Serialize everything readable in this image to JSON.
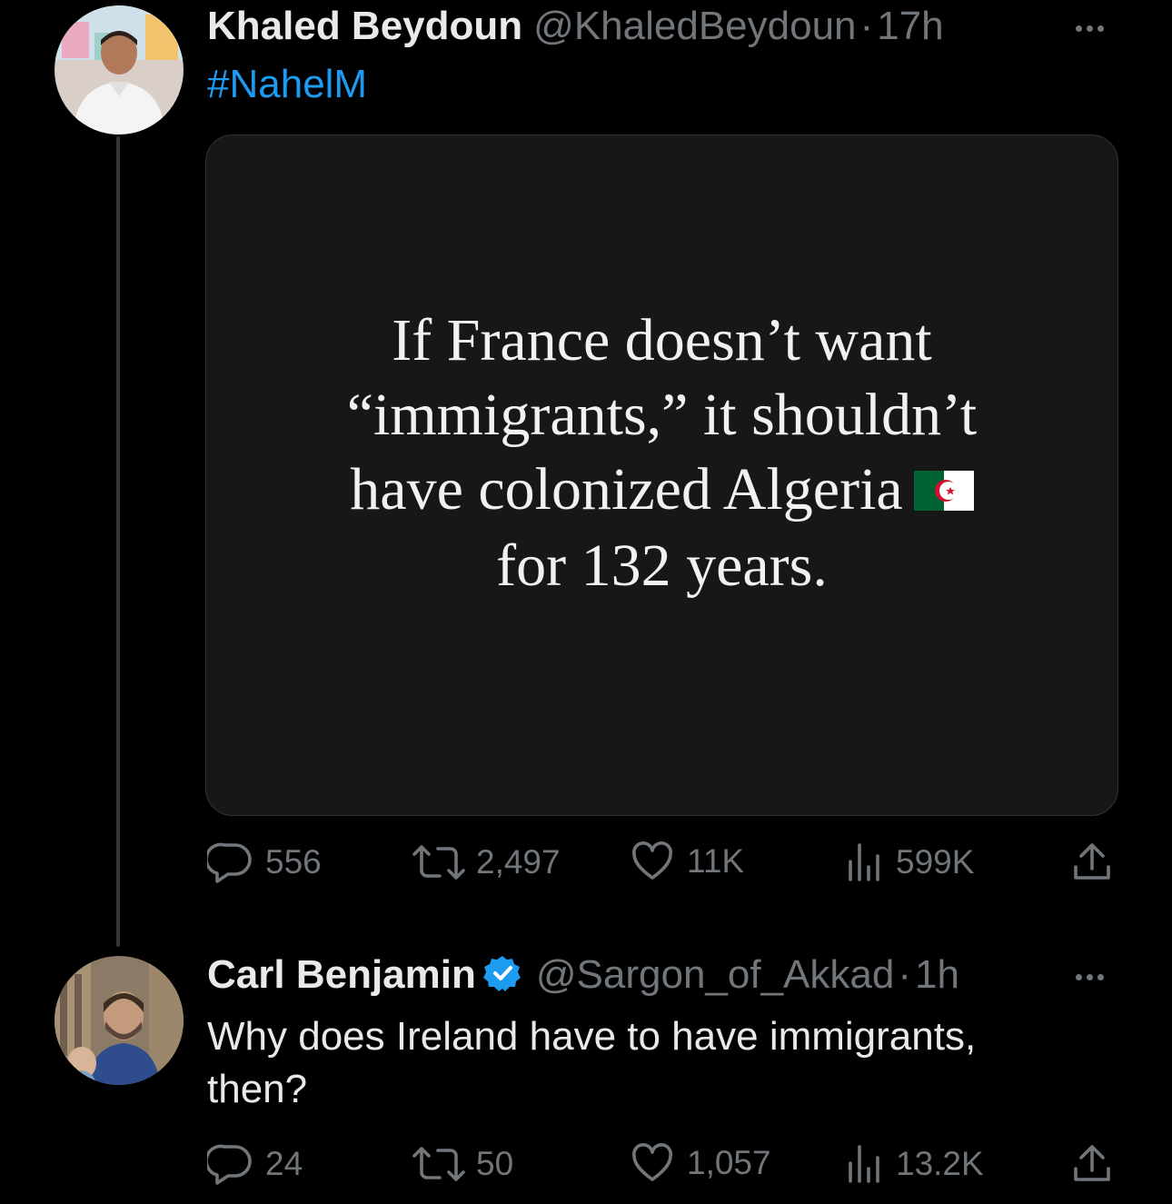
{
  "tweet": {
    "author_name": "Khaled Beydoun",
    "author_handle": "@KhaledBeydoun",
    "separator": "·",
    "time": "17h",
    "hashtag": "#NahelM",
    "image_quote_lines": [
      "If France doesn’t want",
      "“immigrants,” it shouldn’t",
      "have colonized Algeria",
      "for 132 years."
    ],
    "stats": {
      "replies": "556",
      "retweets": "2,497",
      "likes": "11K",
      "views": "599K"
    }
  },
  "reply": {
    "author_name": "Carl Benjamin",
    "author_handle": "@Sargon_of_Akkad",
    "separator": "·",
    "time": "1h",
    "verified": true,
    "text": "Why does Ireland have to have immigrants, then?",
    "stats": {
      "replies": "24",
      "retweets": "50",
      "likes": "1,057",
      "views": "13.2K"
    }
  },
  "colors": {
    "background": "#000000",
    "text": "#e7e9ea",
    "muted": "#71767b",
    "link": "#1d9bf0",
    "thread_line": "#333639",
    "algeria_green": "#006233",
    "algeria_red": "#d21034"
  },
  "icons": [
    "reply-icon",
    "retweet-icon",
    "like-icon",
    "views-icon",
    "share-icon",
    "more-icon",
    "verified-badge-icon",
    "algeria-flag-icon"
  ]
}
